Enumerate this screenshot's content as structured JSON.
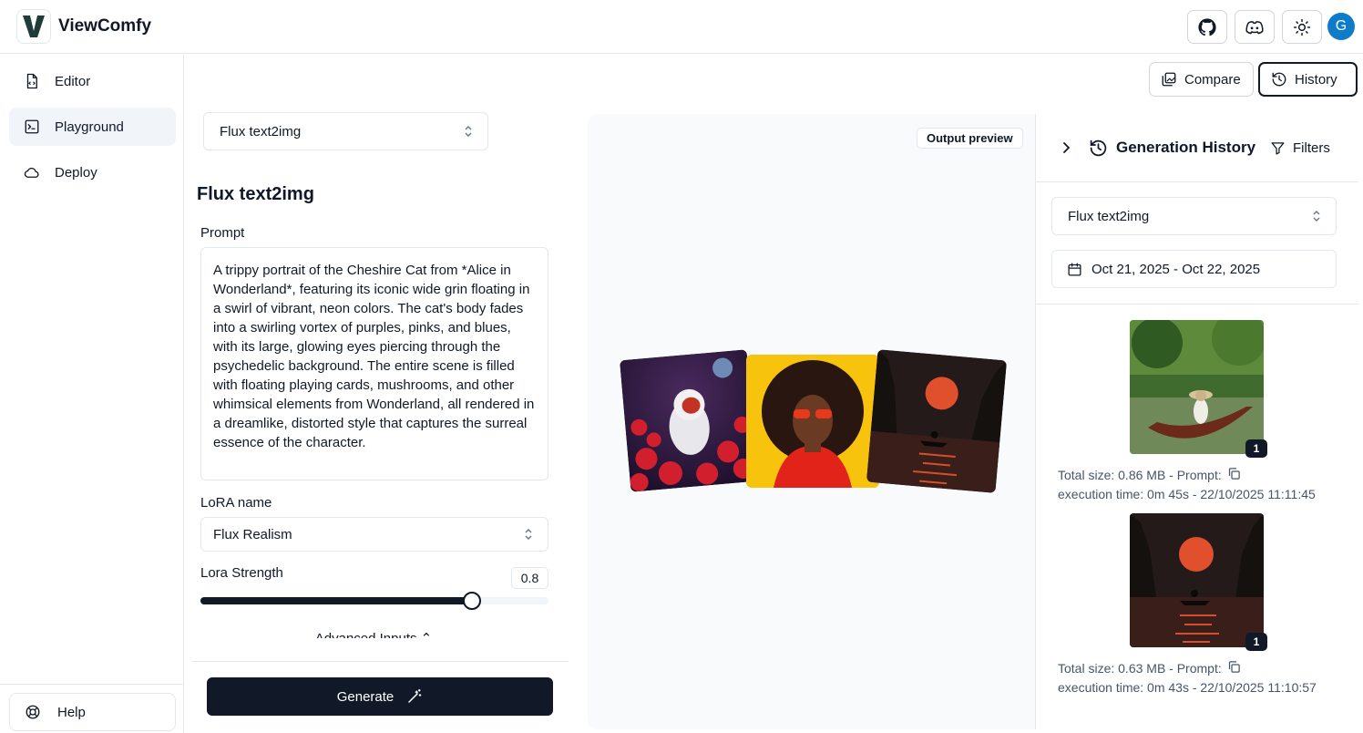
{
  "app": {
    "title": "ViewComfy",
    "logo_letter": "V",
    "avatar_initial": "G"
  },
  "topbar": {
    "icons": [
      "github-icon",
      "discord-icon",
      "sun-icon"
    ]
  },
  "sidebar": {
    "items": [
      {
        "label": "Editor",
        "icon": "file-icon"
      },
      {
        "label": "Playground",
        "icon": "terminal-icon"
      },
      {
        "label": "Deploy",
        "icon": "cloud-icon"
      }
    ],
    "help_label": "Help"
  },
  "actions": {
    "compare_label": "Compare",
    "history_label": "History"
  },
  "form": {
    "workflow_select": "Flux text2img",
    "title": "Flux text2img",
    "prompt_label": "Prompt",
    "prompt_value": "A trippy portrait of the Cheshire Cat from *Alice in Wonderland*, featuring its iconic wide grin floating in a swirl of vibrant, neon colors. The cat's body fades into a swirling vortex of purples, pinks, and blues, with its large, glowing eyes piercing through the psychedelic background. The entire scene is filled with floating playing cards, mushrooms, and other whimsical elements from Wonderland, all rendered in a dreamlike, distorted style that captures the surreal essence of the character.",
    "lora_label": "LoRA name",
    "lora_value": "Flux Realism",
    "strength_label": "Lora Strength",
    "strength_value": "0.8",
    "strength_fraction": 0.78,
    "advanced_label": "Advanced Inputs",
    "generate_label": "Generate"
  },
  "preview": {
    "badge": "Output preview"
  },
  "history": {
    "title": "Generation History",
    "filters_label": "Filters",
    "workflow_select": "Flux text2img",
    "date_range": "Oct 21, 2025 - Oct 22, 2025",
    "entries": [
      {
        "count": "1",
        "size_line": "Total size: 0.86 MB - Prompt:",
        "time_line": "execution time: 0m 45s - 22/10/2025 11:11:45"
      },
      {
        "count": "1",
        "size_line": "Total size: 0.63 MB - Prompt:",
        "time_line": "execution time: 0m 43s - 22/10/2025 11:10:57"
      }
    ]
  },
  "colors": {
    "primary": "#111827",
    "accent_avatar": "#0e7cc9",
    "border": "#e2e8f0",
    "preview_bg": "#f8fafc"
  }
}
